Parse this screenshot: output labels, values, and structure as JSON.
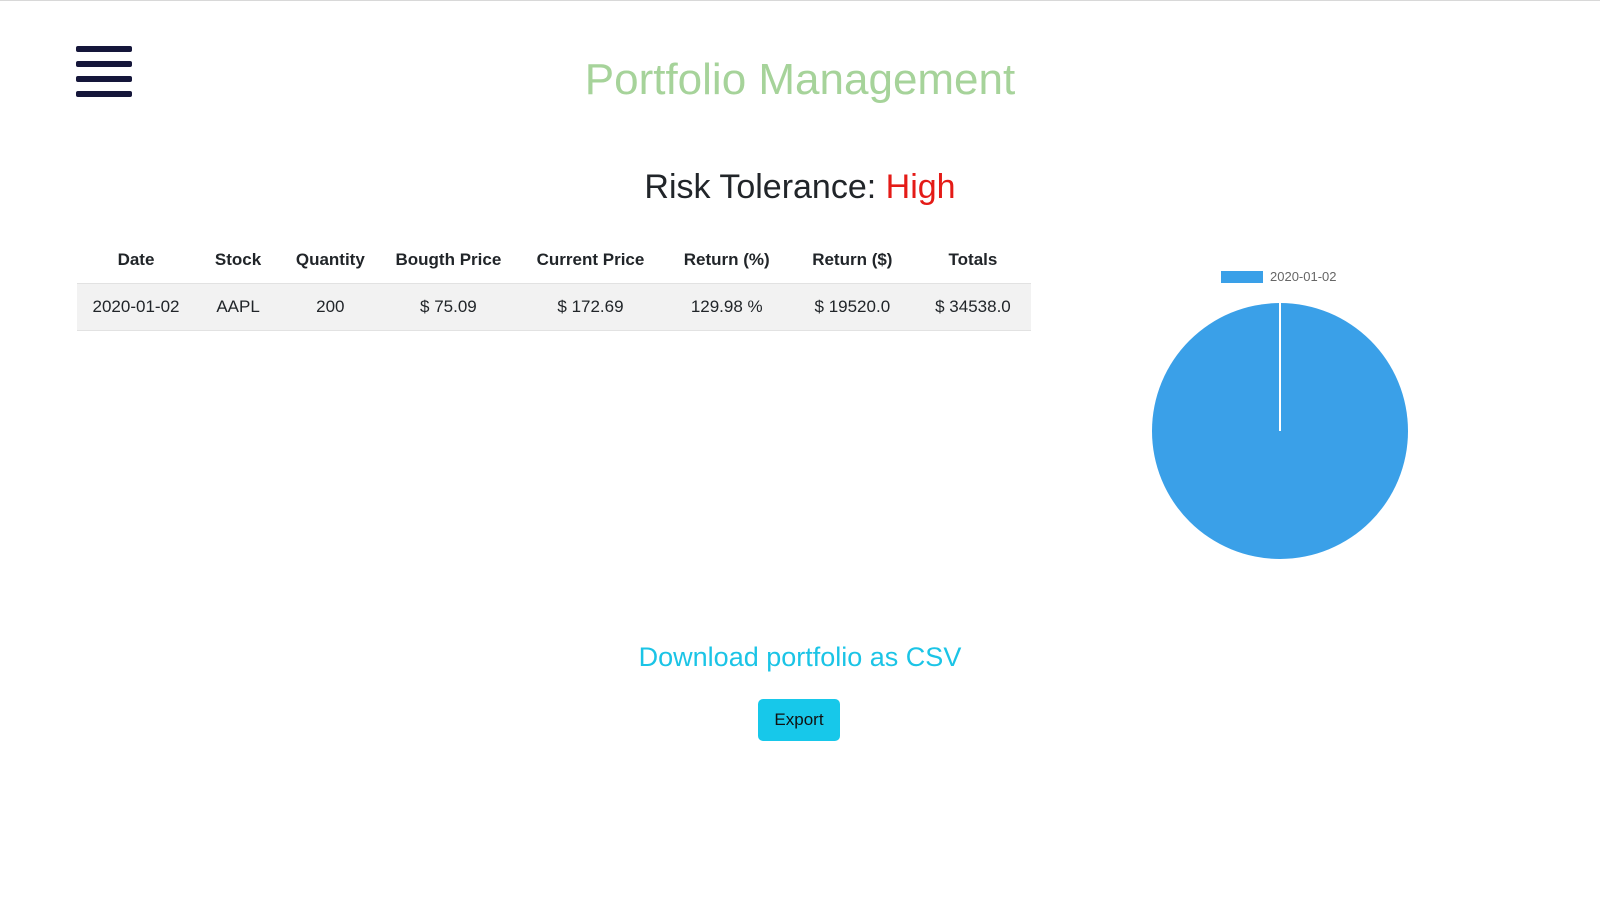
{
  "header": {
    "menu_icon": "hamburger-menu-icon",
    "title": "Portfolio Management",
    "title_color": "#a6d39a"
  },
  "risk": {
    "label": "Risk Tolerance:",
    "value": "High",
    "value_color": "#e41b17"
  },
  "table": {
    "headers": [
      "Date",
      "Stock",
      "Quantity",
      "Bougth Price",
      "Current Price",
      "Return (%)",
      "Return ($)",
      "Totals"
    ],
    "rows": [
      [
        "2020-01-02",
        "AAPL",
        "200",
        "$ 75.09",
        "$ 172.69",
        "129.98 %",
        "$ 19520.0",
        "$ 34538.0"
      ]
    ]
  },
  "chart_data": {
    "type": "pie",
    "labels": [
      "2020-01-02"
    ],
    "values": [
      34538.0
    ],
    "colors": [
      "#3aa0e8"
    ],
    "legend": "top"
  },
  "download": {
    "link_text": "Download portfolio as CSV",
    "link_color": "#1bc4e6",
    "button_label": "Export",
    "button_color": "#17c8ea"
  }
}
